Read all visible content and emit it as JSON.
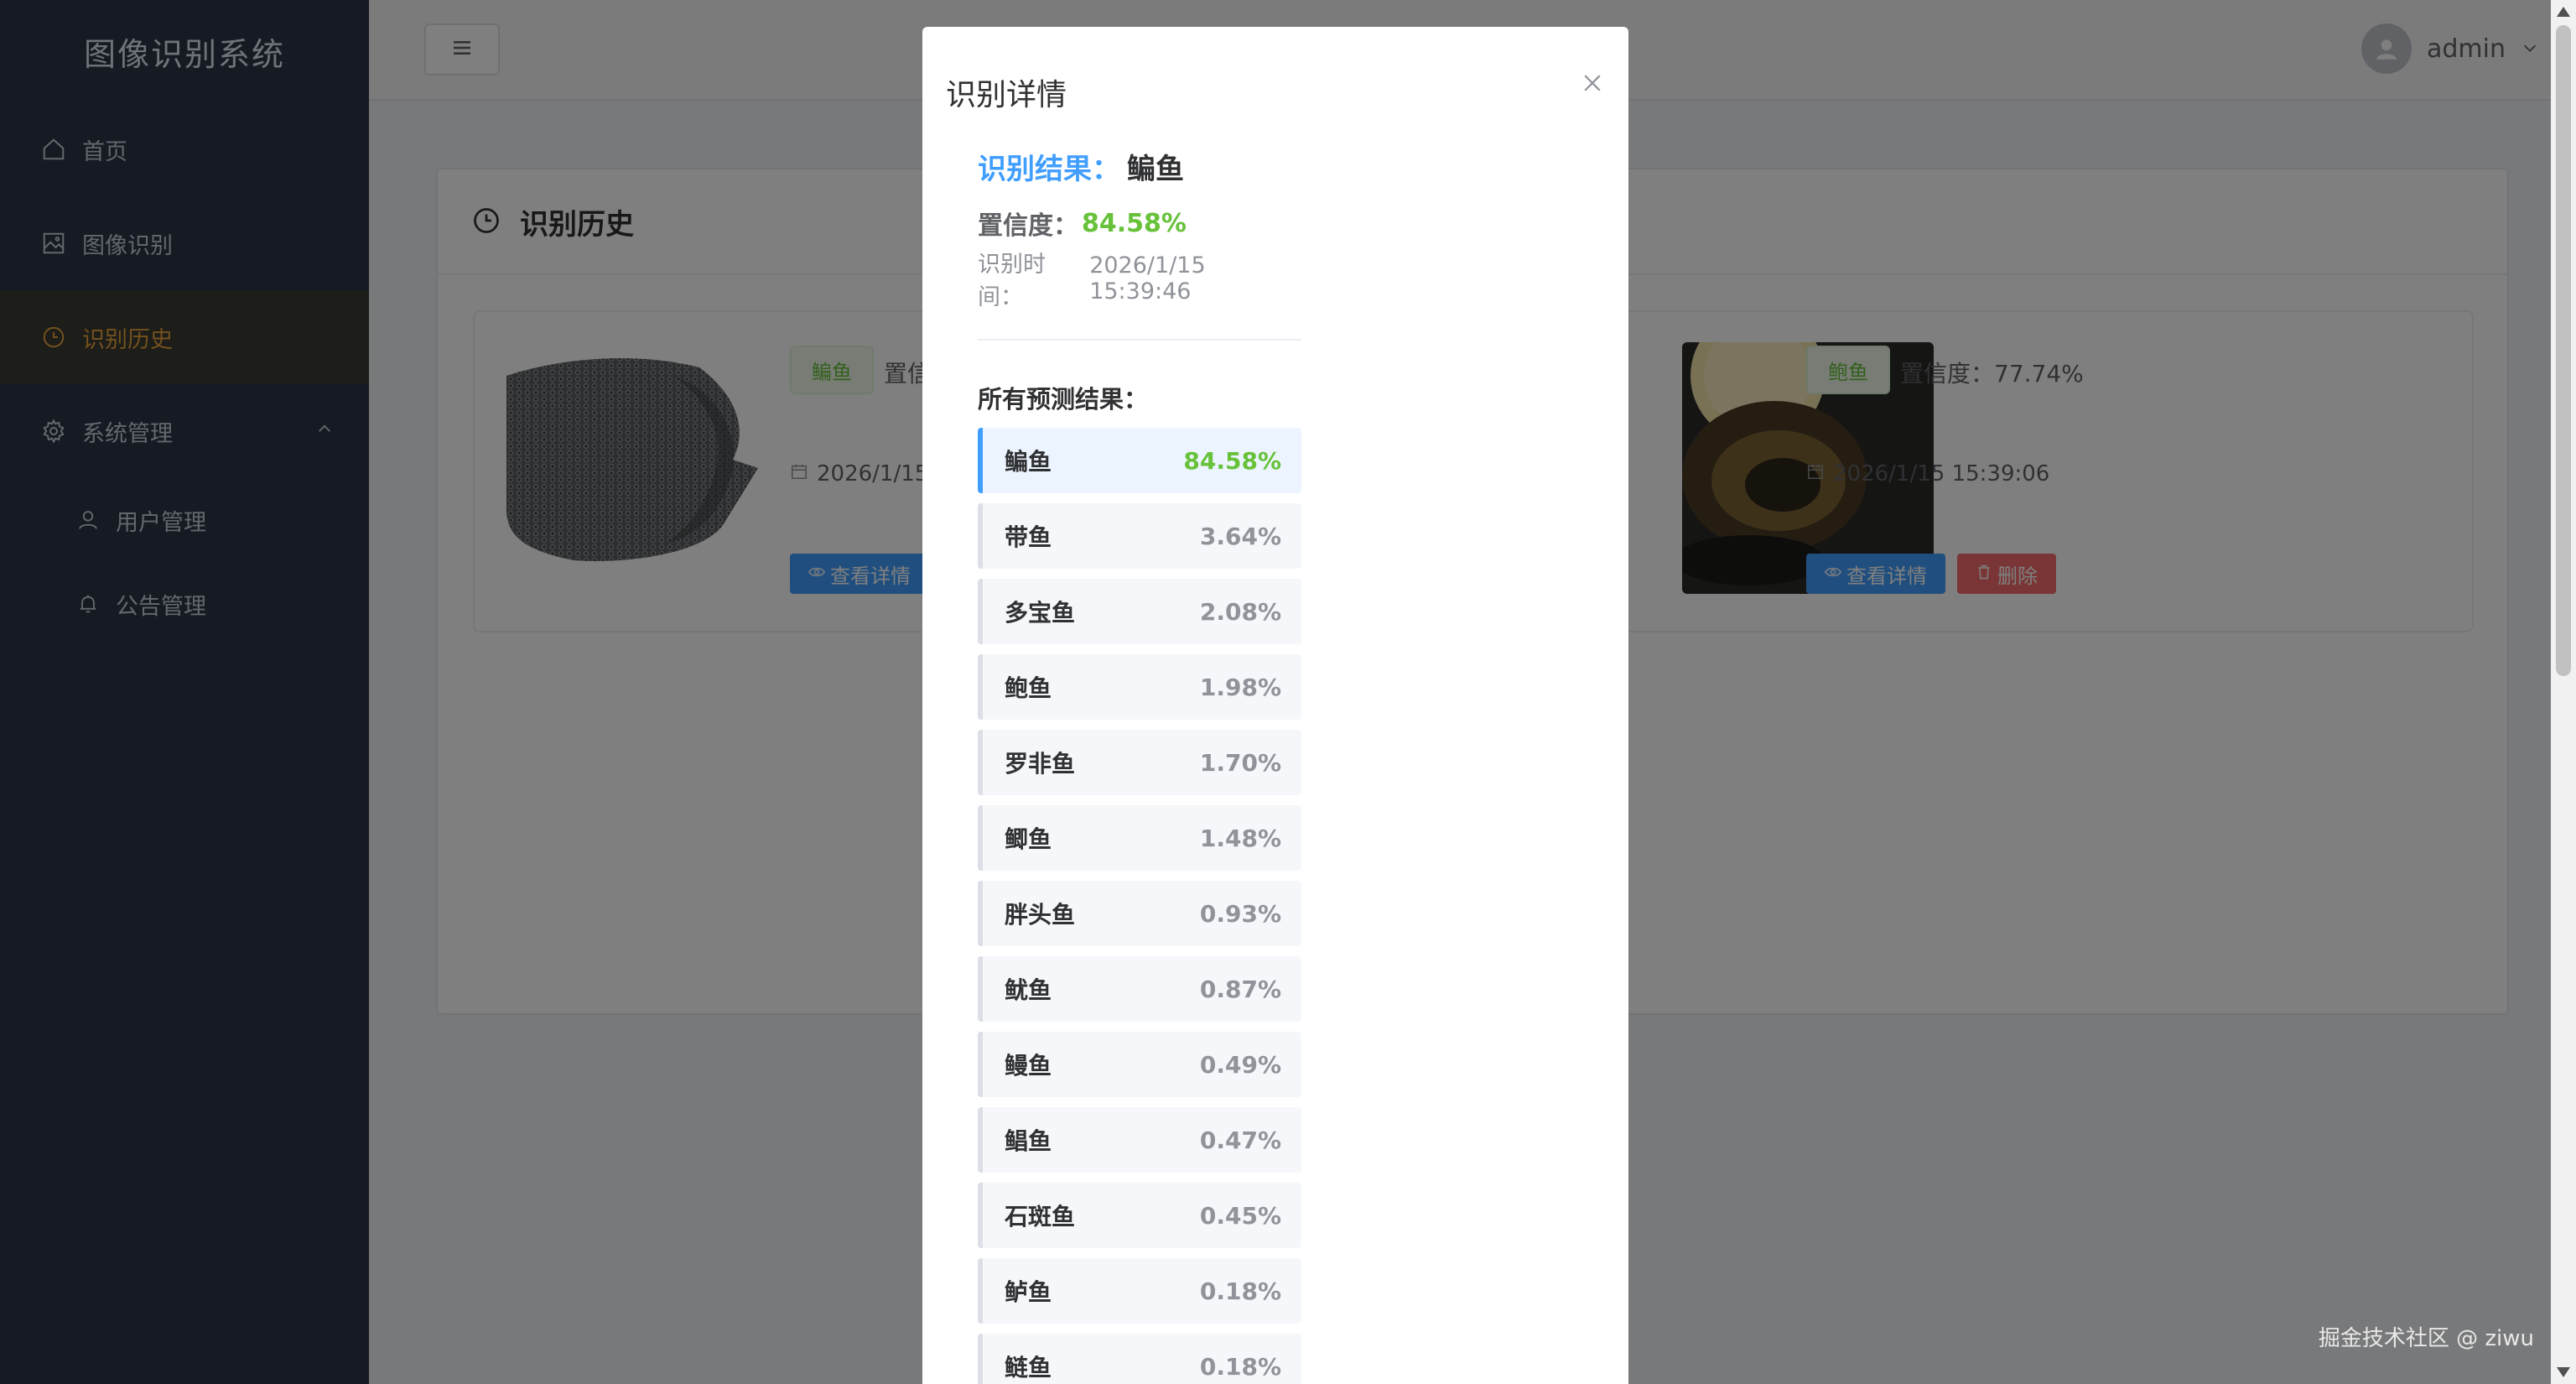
{
  "sidebar": {
    "logo": "图像识别系统",
    "items": [
      {
        "label": "首页",
        "icon": "home-icon"
      },
      {
        "label": "图像识别",
        "icon": "image-icon"
      },
      {
        "label": "识别历史",
        "icon": "clock-icon",
        "active": true
      },
      {
        "label": "系统管理",
        "icon": "gear-icon"
      }
    ],
    "subitems": [
      {
        "label": "用户管理",
        "icon": "user-icon"
      },
      {
        "label": "公告管理",
        "icon": "bell-icon"
      }
    ]
  },
  "header": {
    "username": "admin"
  },
  "history": {
    "title": "识别历史",
    "items": [
      {
        "tag": "鳊鱼",
        "conf_prefix": "置信",
        "date": "2026/1/15",
        "detail_label": "查看详情"
      },
      {
        "tag": "鲍鱼",
        "conf_text": "置信度：77.74%",
        "date": "2026/1/15 15:39:06",
        "detail_label": "查看详情",
        "delete_label": "删除"
      }
    ]
  },
  "dialog": {
    "title": "识别详情",
    "result_label": "识别结果：",
    "result_value": "鳊鱼",
    "confidence_label": "置信度：",
    "confidence_value": "84.58%",
    "time_label": "识别时间：",
    "time_value": "2026/1/15 15:39:46",
    "predictions_title": "所有预测结果：",
    "predictions": [
      {
        "name": "鳊鱼",
        "pct": "84.58%"
      },
      {
        "name": "带鱼",
        "pct": "3.64%"
      },
      {
        "name": "多宝鱼",
        "pct": "2.08%"
      },
      {
        "name": "鲍鱼",
        "pct": "1.98%"
      },
      {
        "name": "罗非鱼",
        "pct": "1.70%"
      },
      {
        "name": "鲫鱼",
        "pct": "1.48%"
      },
      {
        "name": "胖头鱼",
        "pct": "0.93%"
      },
      {
        "name": "鱿鱼",
        "pct": "0.87%"
      },
      {
        "name": "鳗鱼",
        "pct": "0.49%"
      },
      {
        "name": "鲳鱼",
        "pct": "0.47%"
      },
      {
        "name": "石斑鱼",
        "pct": "0.45%"
      },
      {
        "name": "鲈鱼",
        "pct": "0.18%"
      },
      {
        "name": "鲢鱼",
        "pct": "0.18%"
      }
    ]
  },
  "watermark": "掘金技术社区 @ ziwu",
  "colors": {
    "sidebar_bg": "#2d3446",
    "active": "#e6a23c",
    "primary": "#409eff",
    "success": "#67c23a",
    "danger": "#f56c6c"
  }
}
